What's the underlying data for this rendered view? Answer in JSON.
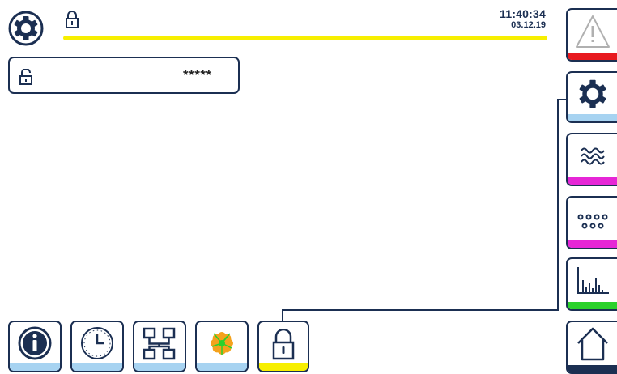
{
  "header": {
    "time": "11:40:34",
    "date": "03.12.19"
  },
  "login": {
    "password_value": "*****"
  },
  "side_nav": [
    {
      "name": "alarm",
      "icon": "warning-icon",
      "stripe": "#e8191f"
    },
    {
      "name": "settings",
      "icon": "gear-icon",
      "stripe": "#a7d3f1"
    },
    {
      "name": "water",
      "icon": "waves-icon",
      "stripe": "#e626d6"
    },
    {
      "name": "dosing",
      "icon": "dots-icon",
      "stripe": "#e626d6"
    },
    {
      "name": "trend",
      "icon": "bar-chart-icon",
      "stripe": "#2bd12b"
    },
    {
      "name": "home",
      "icon": "home-icon",
      "stripe": "#1b2f52"
    }
  ],
  "bottom_nav": [
    {
      "name": "info",
      "icon": "info-icon",
      "stripe": "#a7d3f1"
    },
    {
      "name": "clock",
      "icon": "clock-icon",
      "stripe": "#a7d3f1"
    },
    {
      "name": "network",
      "icon": "network-icon",
      "stripe": "#a7d3f1"
    },
    {
      "name": "flower",
      "icon": "flower-icon",
      "stripe": "#a7d3f1"
    },
    {
      "name": "lock",
      "icon": "lock-icon",
      "stripe": "#f7ef00"
    }
  ],
  "colors": {
    "frame": "#1b2f52",
    "status_bar": "#f7ef00"
  }
}
